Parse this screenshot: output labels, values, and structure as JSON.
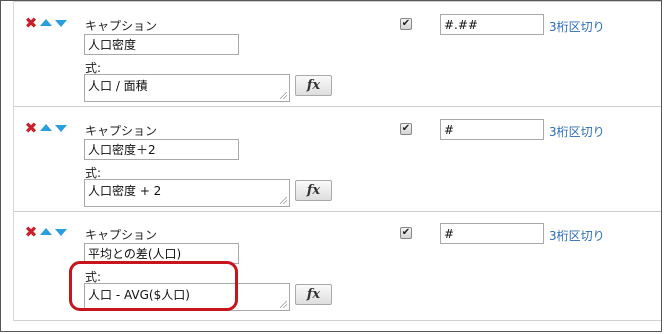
{
  "colors": {
    "delete_icon": "#c8202a",
    "arrow_icon": "#2a9fe0",
    "link": "#2a6db5",
    "highlight": "#c8141c"
  },
  "rows": [
    {
      "caption_label": "キャプション",
      "caption_value": "人口密度",
      "formula_label": "式:",
      "formula_value": "人口 / 面積",
      "fx_label": "fx",
      "visible": true,
      "format_value": "#.##",
      "separator_link": "3桁区切り"
    },
    {
      "caption_label": "キャプション",
      "caption_value": "人口密度＋2",
      "formula_label": "式:",
      "formula_value": "人口密度 + 2",
      "fx_label": "fx",
      "visible": true,
      "format_value": "#",
      "separator_link": "3桁区切り"
    },
    {
      "caption_label": "キャプション",
      "caption_value": "平均との差(人口)",
      "formula_label": "式:",
      "formula_value": "人口 - AVG($人口)",
      "fx_label": "fx",
      "visible": true,
      "format_value": "#",
      "separator_link": "3桁区切り"
    }
  ]
}
